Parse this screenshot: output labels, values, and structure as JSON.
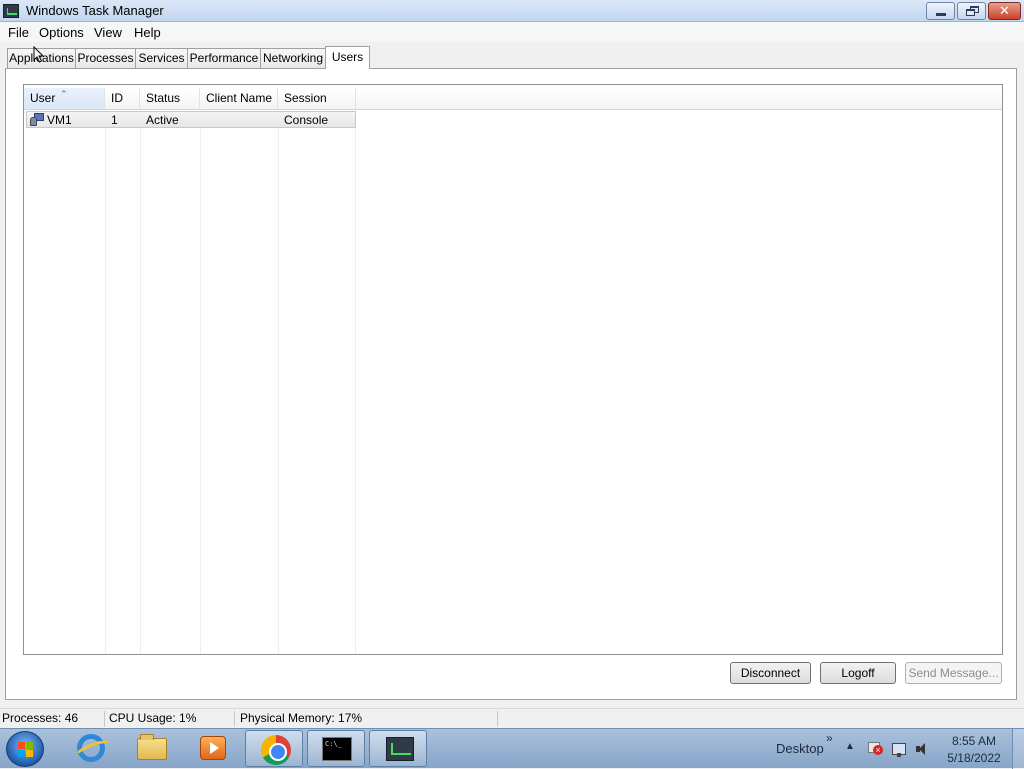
{
  "window": {
    "title": "Windows Task Manager",
    "icon": "task-manager-icon"
  },
  "menu": {
    "items": [
      "File",
      "Options",
      "View",
      "Help"
    ]
  },
  "tabs": [
    {
      "label": "Applications",
      "active": false
    },
    {
      "label": "Processes",
      "active": false
    },
    {
      "label": "Services",
      "active": false
    },
    {
      "label": "Performance",
      "active": false
    },
    {
      "label": "Networking",
      "active": false
    },
    {
      "label": "Users",
      "active": true
    }
  ],
  "users_table": {
    "columns": [
      "User",
      "ID",
      "Status",
      "Client Name",
      "Session"
    ],
    "sorted_column": "User",
    "rows": [
      {
        "user": "VM1",
        "id": "1",
        "status": "Active",
        "client_name": "",
        "session": "Console",
        "selected": true
      }
    ]
  },
  "buttons": {
    "disconnect": "Disconnect",
    "logoff": "Logoff",
    "send_message": "Send Message..."
  },
  "status_bar": {
    "processes": "Processes: 46",
    "cpu": "CPU Usage: 1%",
    "memory": "Physical Memory: 17%"
  },
  "taskbar": {
    "desktop_label": "Desktop",
    "chevron": "»",
    "tray_arrow": "▲",
    "time": "8:55 AM",
    "date": "5/18/2022",
    "apps": [
      "internet-explorer-icon",
      "file-explorer-icon",
      "media-player-icon",
      "chrome-icon",
      "command-prompt-icon",
      "task-manager-icon"
    ]
  },
  "colors": {
    "titlebar": "#c2d6ef",
    "taskbar": "#87a5c8",
    "selected_row": "#e6e6e6"
  }
}
